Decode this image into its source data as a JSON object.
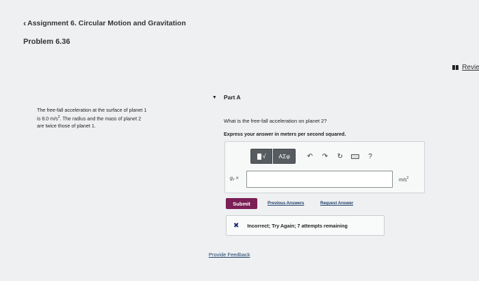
{
  "breadcrumb": {
    "chevron": "‹",
    "text": "Assignment 6. Circular Motion and Gravitation"
  },
  "problem": {
    "title": "Problem 6.36"
  },
  "review": {
    "label": "Review"
  },
  "problem_text": {
    "line1": "The free-fall acceleration at the surface of planet 1",
    "line2a": "is 8.0 m/s",
    "line2_sup": "2",
    "line2b": ". The radius and the mass of planet 2",
    "line3": "are twice those of planet 1."
  },
  "part": {
    "label": "Part A"
  },
  "question": "What is the free-fall acceleration on planet 2?",
  "instruction": "Express your answer in meters per second squared.",
  "toolbar": {
    "template_icon": "√",
    "greek_label": "ΑΣφ",
    "undo_icon": "↶",
    "redo_icon": "↷",
    "reset_icon": "↻",
    "help_label": "?"
  },
  "answer": {
    "variable_label": "g₂ =",
    "value": "",
    "unit_base": "m/s",
    "unit_sup": "2"
  },
  "actions": {
    "submit_label": "Submit",
    "previous_answers_label": "Previous Answers",
    "request_answer_label": "Request Answer"
  },
  "feedback": {
    "icon": "✖",
    "text": "Incorrect; Try Again; 7 attempts remaining"
  },
  "footer": {
    "provide_feedback_label": "Provide Feedback"
  },
  "colors": {
    "submit": "#7b1f56",
    "link": "#1f3f6b",
    "incorrect_icon": "#1f2a7a"
  }
}
